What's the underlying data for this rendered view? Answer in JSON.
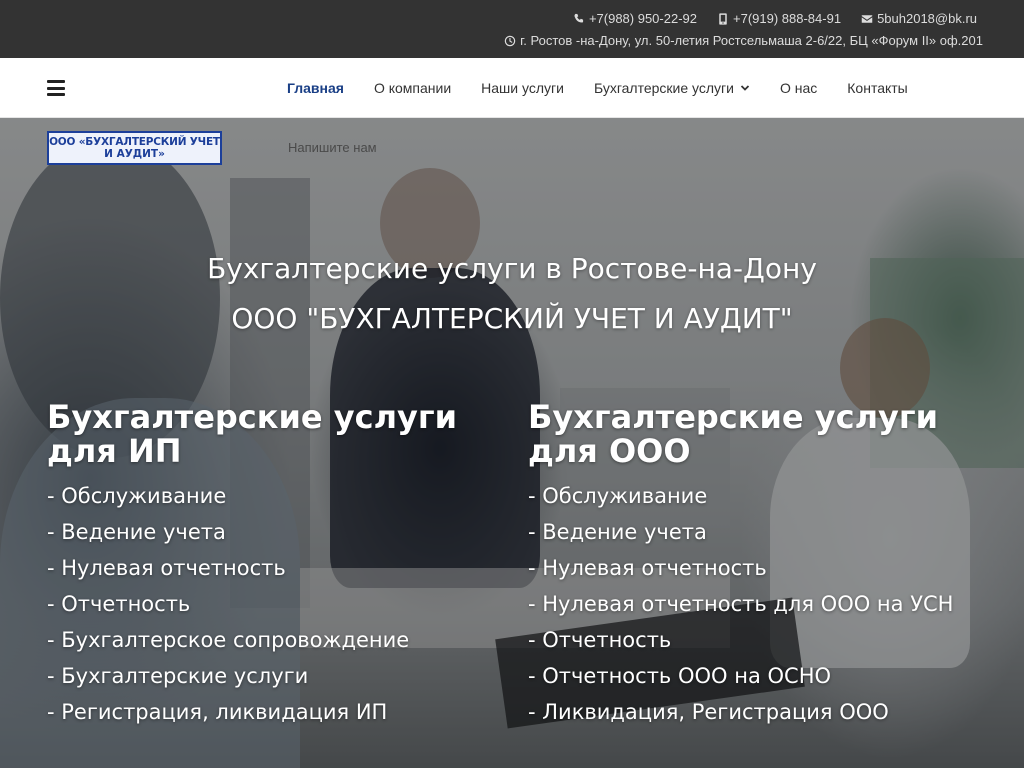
{
  "topbar": {
    "phone1": "+7(988) 950-22-92",
    "phone2": "+7(919) 888-84-91",
    "email": "5buh2018@bk.ru",
    "address": "г. Ростов -на-Дону, ул. 50-летия Ростсельмаша 2-6/22, БЦ «Форум II» оф.201"
  },
  "nav": {
    "items": [
      "Главная",
      "О компании",
      "Наши услуги",
      "Бухгалтерские услуги",
      "О нас",
      "Контакты"
    ]
  },
  "logo": {
    "line1": "ООО «БУХГАЛТЕРСКИЙ УЧЕТ",
    "line2": "И АУДИТ»"
  },
  "hero": {
    "write_us": "Напишите нам",
    "title1": "Бухгалтерские услуги в Ростове-на-Дону",
    "title2": "ООО \"БУХГАЛТЕРСКИЙ УЧЕТ И АУДИТ\""
  },
  "ip": {
    "heading": "Бухгалтерские услуги для ИП",
    "items": [
      "- Обслуживание",
      "- Ведение учета",
      "- Нулевая отчетность",
      "- Отчетность",
      "- Бухгалтерское сопровождение",
      "- Бухгалтерские услуги",
      "- Регистрация, ликвидация ИП"
    ]
  },
  "ooo": {
    "heading": "Бухгалтерские услуги для ООО",
    "items": [
      "- Обслуживание",
      "- Ведение учета",
      "- Нулевая отчетность",
      "- Нулевая отчетность для ООО на УСН",
      "- Отчетность",
      "- Отчетность ООО на ОСНО",
      "- Ликвидация, Регистрация ООО"
    ]
  },
  "colors": {
    "topbar": "#333333",
    "nav_active": "#1a3f86",
    "logo_blue": "#1c3f9a"
  }
}
